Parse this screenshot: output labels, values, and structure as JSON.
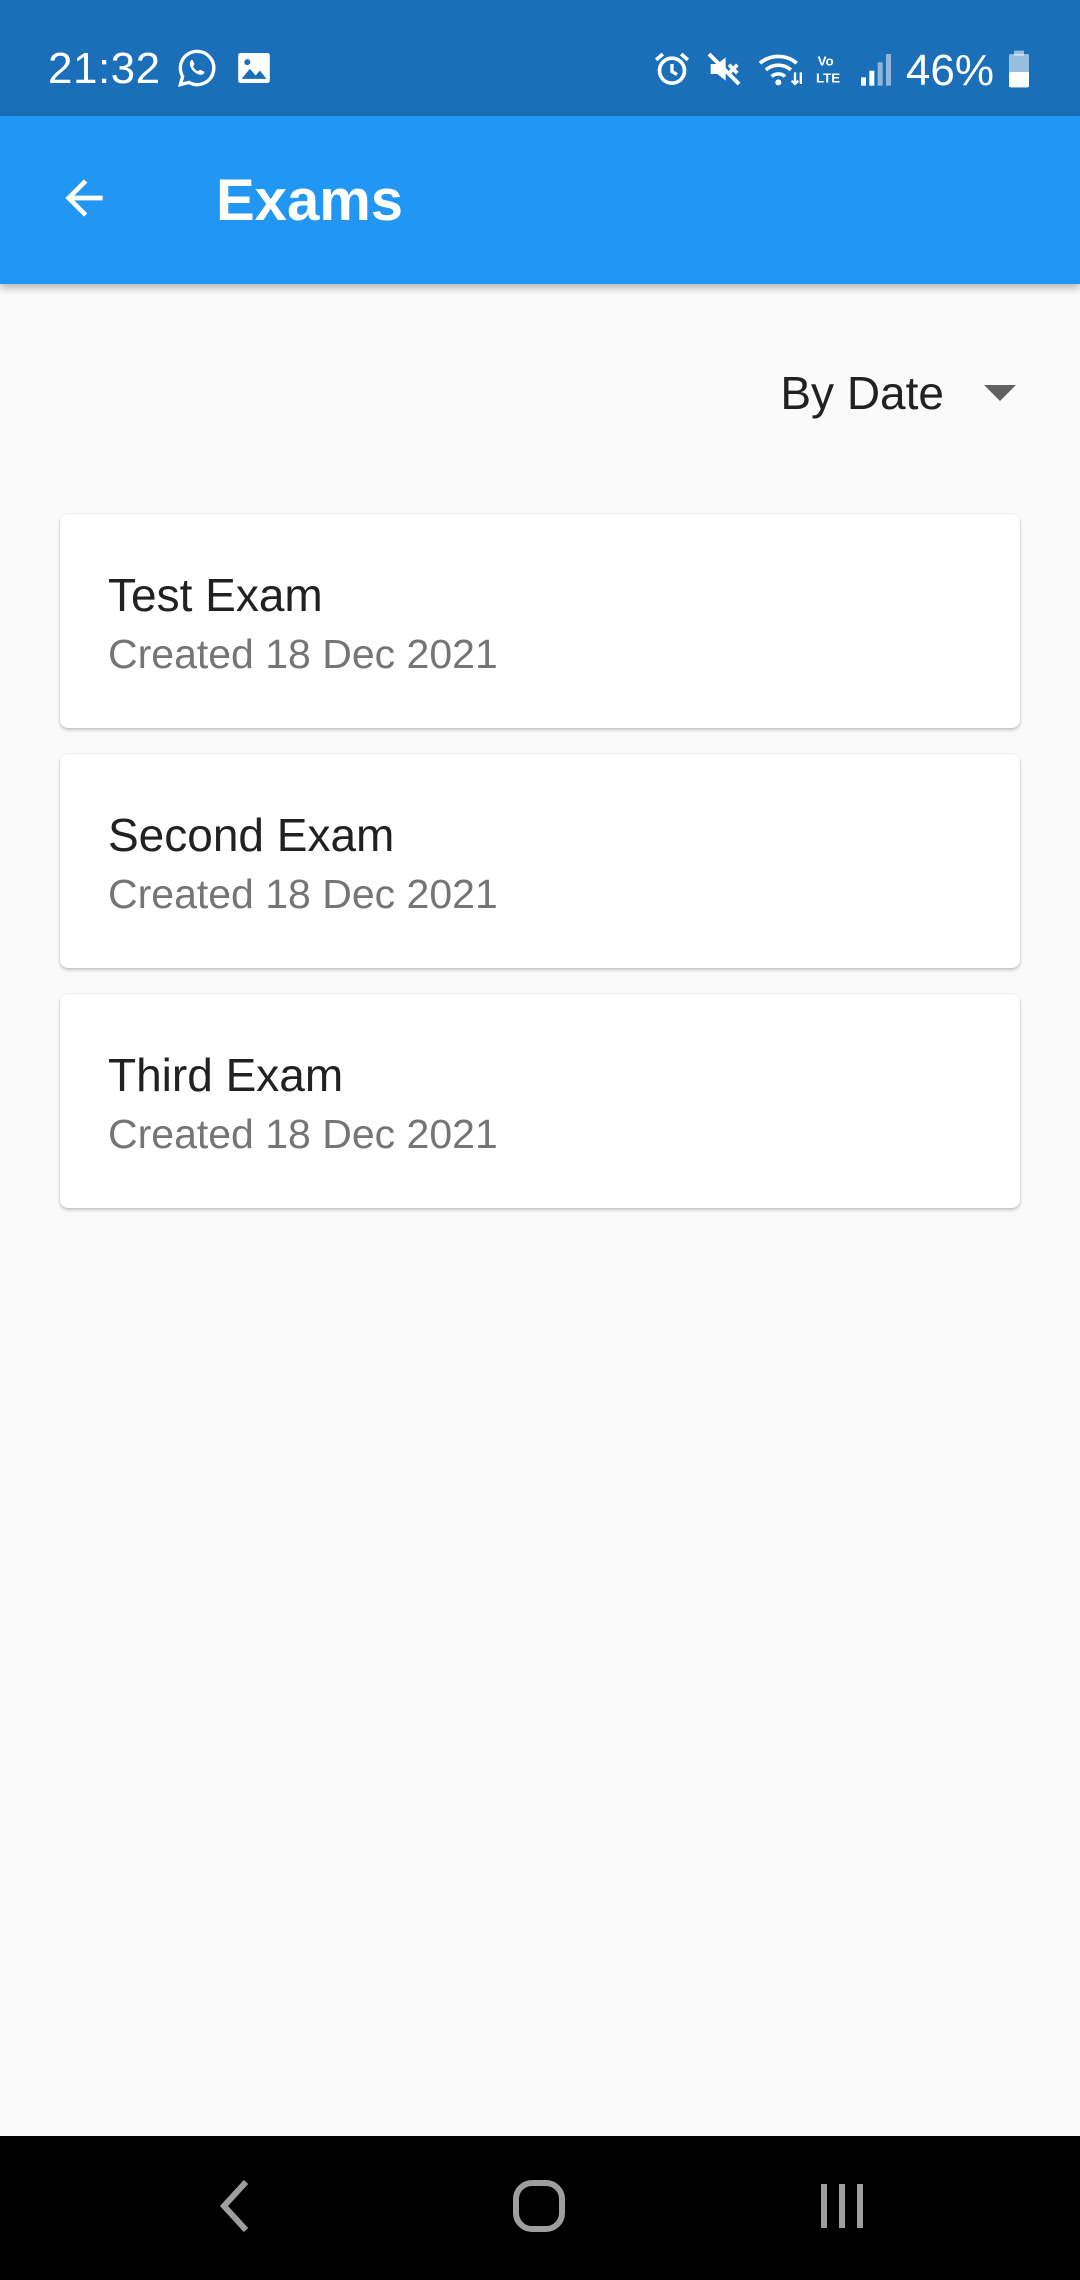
{
  "status_bar": {
    "time": "21:32",
    "battery_percent": "46%",
    "battery_level": 0.46,
    "left_icons": [
      "whatsapp-icon",
      "image-icon"
    ],
    "right_icons": [
      "alarm-icon",
      "mute-icon",
      "wifi-icon",
      "volte-icon",
      "signal-icon",
      "battery-icon"
    ]
  },
  "app_bar": {
    "title": "Exams",
    "background": "#2196f3"
  },
  "sort": {
    "selected": "By Date"
  },
  "exams": [
    {
      "title": "Test Exam",
      "created": "Created 18 Dec 2021"
    },
    {
      "title": "Second Exam",
      "created": "Created 18 Dec 2021"
    },
    {
      "title": "Third Exam",
      "created": "Created 18 Dec 2021"
    }
  ],
  "nav_bar": {
    "icons": [
      "back-nav-icon",
      "home-nav-icon",
      "recents-nav-icon"
    ]
  }
}
